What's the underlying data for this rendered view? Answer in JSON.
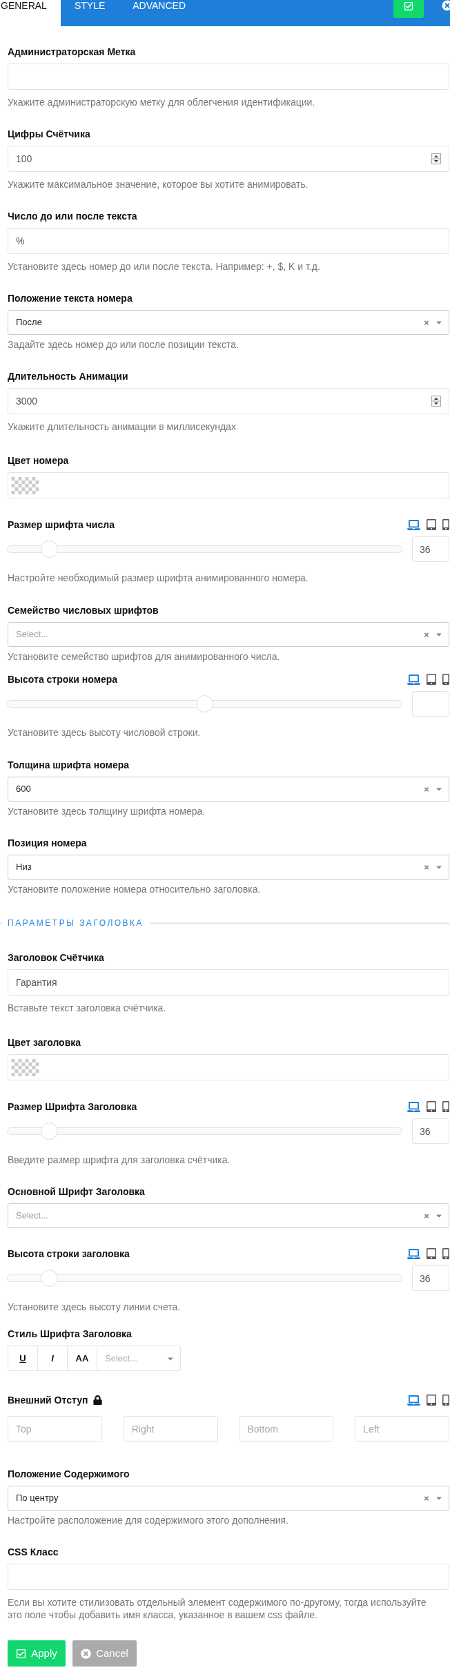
{
  "tabs": [
    {
      "label": "GENERAL",
      "selected": true
    },
    {
      "label": "STYLE",
      "selected": false
    },
    {
      "label": "ADVANCED",
      "selected": false
    }
  ],
  "fields": [
    {
      "kind": "text",
      "label": "Администраторская Метка",
      "help": "Укажите администраторскую метку для облегчения идентификации."
    },
    {
      "kind": "number",
      "label": "Цифры Счётчика",
      "value": "100",
      "help": "Укажите максимальное значение, которое вы хотите анимировать."
    },
    {
      "kind": "text",
      "label": "Число до или после текста",
      "value": "%",
      "help": "Установите здесь номер до или после текста. Например: +, $, K и т.д."
    },
    {
      "kind": "select",
      "label": "Положение текста номера",
      "value": "После",
      "help": "Задайте здесь номер до или после позиции текста."
    },
    {
      "kind": "number",
      "label": "Длительность Анимации",
      "value": "3000",
      "help": "Укажите длительность анимации в миллисекундах"
    },
    {
      "kind": "color",
      "label": "Цвет номера"
    },
    {
      "kind": "slider",
      "label": "Размер шрифта числа",
      "devices": [
        {
          "kind": "desktop",
          "selected": true
        },
        {
          "kind": "tablet",
          "selected": false
        },
        {
          "kind": "mobile",
          "selected": false
        }
      ],
      "level": 0.09,
      "value": "36",
      "help": "Настройте необходимый размер шрифта анимированного номера."
    },
    {
      "kind": "select",
      "label": "Семейство числовых шрифтов",
      "placeholder": "Select...",
      "help": "Установите семейство шрифтов для анимированного числа."
    },
    {
      "kind": "slider",
      "label": "Высота строки номера",
      "devices": [
        {
          "kind": "desktop",
          "selected": true
        },
        {
          "kind": "tablet",
          "selected": false
        },
        {
          "kind": "mobile",
          "selected": false
        }
      ],
      "level": 0.5,
      "help": "Установите здесь высоту числовой строки."
    },
    {
      "kind": "select",
      "label": "Толщина шрифта номера",
      "value": "600",
      "help": "Установите здесь толщину шрифта номера."
    },
    {
      "kind": "select",
      "label": "Позиция номера",
      "value": "Низ",
      "help": "Установите положение номера относительно заголовка."
    },
    {
      "kind": "heading",
      "label": "ПАРАМЕТРЫ ЗАГОЛОВКА"
    },
    {
      "kind": "text",
      "label": "Заголовок Счётчика",
      "value": "Гарантия",
      "help": "Вставьте текст заголовка счётчика."
    },
    {
      "kind": "color",
      "label": "Цвет заголовка"
    },
    {
      "kind": "slider",
      "label": "Размер Шрифта Заголовка",
      "devices": [
        {
          "kind": "desktop",
          "selected": true
        },
        {
          "kind": "tablet",
          "selected": false
        },
        {
          "kind": "mobile",
          "selected": false
        }
      ],
      "level": 0.09,
      "value": "36",
      "help": "Введите размер шрифта для заголовка счётчика."
    },
    {
      "kind": "select",
      "label": "Основной Шрифт Заголовка",
      "placeholder": "Select..."
    },
    {
      "kind": "slider",
      "label": "Высота строки заголовка",
      "devices": [
        {
          "kind": "desktop",
          "selected": true
        },
        {
          "kind": "tablet",
          "selected": false
        },
        {
          "kind": "mobile",
          "selected": false
        }
      ],
      "level": 0.09,
      "value": "36",
      "help": "Установите здесь высоту линии счета."
    },
    {
      "kind": "font_style",
      "label": "Стиль Шрифта Заголовка",
      "buttons": [
        {
          "kind": "underline",
          "label": "U"
        },
        {
          "kind": "italic",
          "label": "I"
        },
        {
          "kind": "uppercase",
          "label": "AA"
        }
      ],
      "placeholder": "Select..."
    },
    {
      "kind": "spacing",
      "label": "Внешний Отступ",
      "locked": true,
      "devices": [
        {
          "kind": "desktop",
          "selected": true
        },
        {
          "kind": "tablet",
          "selected": false
        },
        {
          "kind": "mobile",
          "selected": false
        }
      ],
      "inputs": [
        {
          "placeholder": "Top"
        },
        {
          "placeholder": "Right"
        },
        {
          "placeholder": "Bottom"
        },
        {
          "placeholder": "Left"
        }
      ]
    },
    {
      "kind": "select",
      "label": "Положение Содержимого",
      "value": "По центру",
      "help": "Настройте расположение для содержимого этого дополнения."
    },
    {
      "kind": "text",
      "label": "CSS Класс",
      "help": "Если вы хотите стилизовать отдельный элемент содержимого по-другому, тогда используйте это поле чтобы добавить имя класса, указанное в вашем css файле."
    }
  ],
  "buttons": [
    {
      "kind": "apply",
      "label": "Apply"
    },
    {
      "kind": "cancel",
      "label": "Cancel"
    }
  ]
}
